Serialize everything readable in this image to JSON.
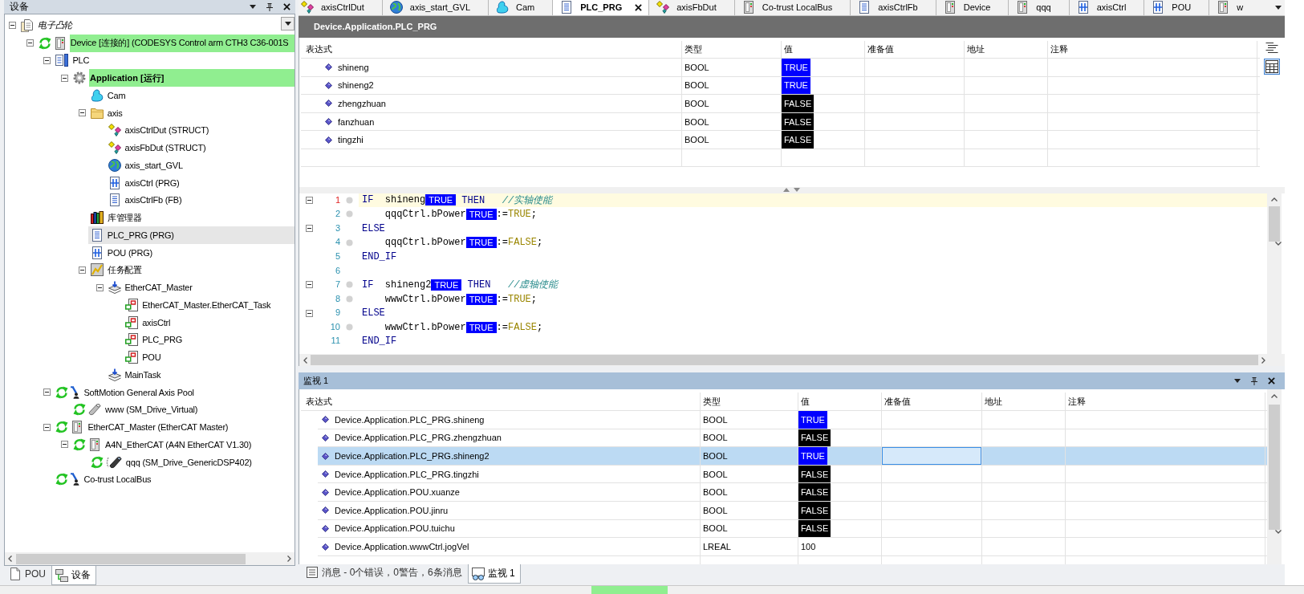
{
  "devices_panel": {
    "title": "设备",
    "tree": [
      {
        "label": "电子凸轮",
        "kind": "project",
        "online": false,
        "highlighted": false,
        "active": false,
        "selected": false,
        "expanded": true,
        "children": [
          {
            "label": "Device [连接的] (CODESYS Control arm CTH3 C36-001S",
            "kind": "device",
            "online": true,
            "highlighted": true,
            "active": false,
            "selected": false,
            "expanded": true,
            "children": [
              {
                "label": "PLC",
                "kind": "plc",
                "online": false,
                "highlighted": false,
                "active": false,
                "selected": false,
                "expanded": true,
                "children": [
                  {
                    "label": "Application [运行]",
                    "kind": "application",
                    "online": false,
                    "highlighted": true,
                    "active": true,
                    "selected": false,
                    "expanded": true,
                    "children": [
                      {
                        "label": "Cam",
                        "kind": "cam",
                        "online": false,
                        "highlighted": false,
                        "active": false,
                        "selected": false,
                        "expanded": false
                      },
                      {
                        "label": "axis",
                        "kind": "folder",
                        "online": false,
                        "highlighted": false,
                        "active": false,
                        "selected": false,
                        "expanded": true,
                        "children": [
                          {
                            "label": "axisCtrlDut (STRUCT)",
                            "kind": "dut",
                            "online": false,
                            "highlighted": false,
                            "active": false,
                            "selected": false,
                            "expanded": false
                          },
                          {
                            "label": "axisFbDut (STRUCT)",
                            "kind": "dut",
                            "online": false,
                            "highlighted": false,
                            "active": false,
                            "selected": false,
                            "expanded": false
                          },
                          {
                            "label": "axis_start_GVL",
                            "kind": "gvl",
                            "online": false,
                            "highlighted": false,
                            "active": false,
                            "selected": false,
                            "expanded": false
                          },
                          {
                            "label": "axisCtrl (PRG)",
                            "kind": "prg",
                            "online": false,
                            "highlighted": false,
                            "active": false,
                            "selected": false,
                            "expanded": false
                          },
                          {
                            "label": "axisCtrlFb (FB)",
                            "kind": "doc",
                            "online": false,
                            "highlighted": false,
                            "active": false,
                            "selected": false,
                            "expanded": false
                          }
                        ]
                      },
                      {
                        "label": "库管理器",
                        "kind": "library",
                        "online": false,
                        "highlighted": false,
                        "active": false,
                        "selected": false,
                        "expanded": false
                      },
                      {
                        "label": "PLC_PRG (PRG)",
                        "kind": "doc",
                        "online": false,
                        "highlighted": false,
                        "active": false,
                        "selected": true,
                        "expanded": false
                      },
                      {
                        "label": "POU (PRG)",
                        "kind": "prg",
                        "online": false,
                        "highlighted": false,
                        "active": false,
                        "selected": false,
                        "expanded": false
                      },
                      {
                        "label": "任务配置",
                        "kind": "taskconfig",
                        "online": false,
                        "highlighted": false,
                        "active": false,
                        "selected": false,
                        "expanded": true,
                        "children": [
                          {
                            "label": "EtherCAT_Master",
                            "kind": "task",
                            "online": false,
                            "highlighted": false,
                            "active": false,
                            "selected": false,
                            "expanded": true,
                            "children": [
                              {
                                "label": "EtherCAT_Master.EtherCAT_Task",
                                "kind": "call",
                                "online": false,
                                "highlighted": false,
                                "active": false,
                                "selected": false,
                                "expanded": false
                              },
                              {
                                "label": "axisCtrl",
                                "kind": "call",
                                "online": false,
                                "highlighted": false,
                                "active": false,
                                "selected": false,
                                "expanded": false
                              },
                              {
                                "label": "PLC_PRG",
                                "kind": "call",
                                "online": false,
                                "highlighted": false,
                                "active": false,
                                "selected": false,
                                "expanded": false
                              },
                              {
                                "label": "POU",
                                "kind": "call",
                                "online": false,
                                "highlighted": false,
                                "active": false,
                                "selected": false,
                                "expanded": false
                              }
                            ]
                          },
                          {
                            "label": "MainTask",
                            "kind": "task",
                            "online": false,
                            "highlighted": false,
                            "active": false,
                            "selected": false,
                            "expanded": false
                          }
                        ]
                      }
                    ]
                  }
                ]
              },
              {
                "label": "SoftMotion General Axis Pool",
                "kind": "pool",
                "online": true,
                "highlighted": false,
                "active": false,
                "selected": false,
                "expanded": true,
                "children": [
                  {
                    "label": "www (SM_Drive_Virtual)",
                    "kind": "drive",
                    "online": true,
                    "highlighted": false,
                    "active": false,
                    "selected": false,
                    "expanded": false
                  }
                ]
              },
              {
                "label": "EtherCAT_Master (EtherCAT Master)",
                "kind": "device",
                "online": true,
                "highlighted": false,
                "active": false,
                "selected": false,
                "expanded": true,
                "children": [
                  {
                    "label": "A4N_EtherCAT (A4N EtherCAT V1.30)",
                    "kind": "device",
                    "online": true,
                    "highlighted": false,
                    "active": false,
                    "selected": false,
                    "expanded": true,
                    "children": [
                      {
                        "label": "qqq (SM_Drive_GenericDSP402)",
                        "kind": "drive_linked",
                        "online": true,
                        "highlighted": false,
                        "active": false,
                        "selected": false,
                        "expanded": false
                      }
                    ]
                  }
                ]
              },
              {
                "label": "Co-trust LocalBus",
                "kind": "pool",
                "online": true,
                "highlighted": false,
                "active": false,
                "selected": false,
                "expanded": false
              }
            ]
          }
        ]
      }
    ],
    "tabs": [
      {
        "label": "POU",
        "kind": "pou",
        "selected": false
      },
      {
        "label": "设备",
        "kind": "devices",
        "selected": true
      }
    ]
  },
  "editor": {
    "tabs": [
      {
        "label": "axisCtrlDut",
        "kind": "dut",
        "selected": false
      },
      {
        "label": "axis_start_GVL",
        "kind": "gvl",
        "selected": false
      },
      {
        "label": "Cam",
        "kind": "cam",
        "selected": false
      },
      {
        "label": "PLC_PRG",
        "kind": "doc",
        "selected": true
      },
      {
        "label": "axisFbDut",
        "kind": "dut",
        "selected": false
      },
      {
        "label": "Co-trust LocalBus",
        "kind": "device",
        "selected": false
      },
      {
        "label": "axisCtrlFb",
        "kind": "doc",
        "selected": false
      },
      {
        "label": "Device",
        "kind": "device",
        "selected": false
      },
      {
        "label": "qqq",
        "kind": "device",
        "selected": false
      },
      {
        "label": "axisCtrl",
        "kind": "prg",
        "selected": false
      },
      {
        "label": "POU",
        "kind": "prg",
        "selected": false
      },
      {
        "label": "w",
        "kind": "device",
        "selected": false
      }
    ],
    "title": "Device.Application.PLC_PRG",
    "variables": {
      "columns": [
        "表达式",
        "类型",
        "值",
        "准备值",
        "地址",
        "注释"
      ],
      "rows": [
        {
          "expression": "shineng",
          "type": "BOOL",
          "value": "TRUE",
          "color": "#0000ff"
        },
        {
          "expression": "shineng2",
          "type": "BOOL",
          "value": "TRUE",
          "color": "#0000ff"
        },
        {
          "expression": "zhengzhuan",
          "type": "BOOL",
          "value": "FALSE",
          "color": "#000000"
        },
        {
          "expression": "fanzhuan",
          "type": "BOOL",
          "value": "FALSE",
          "color": "#000000"
        },
        {
          "expression": "tingzhi",
          "type": "BOOL",
          "value": "FALSE",
          "color": "#000000"
        }
      ]
    },
    "view_buttons": [
      {
        "kind": "lines",
        "selected": false
      },
      {
        "kind": "table",
        "selected": true
      }
    ],
    "code": [
      {
        "number": "1",
        "fold": true,
        "breakpoint_slot": true,
        "selected": true,
        "tokens": [
          {
            "kind": "keyword",
            "text": "IF"
          },
          {
            "kind": "plain",
            "text": "  shineng"
          },
          {
            "kind": "monitor",
            "text": "TRUE",
            "color": "#0000ff"
          },
          {
            "kind": "keyword",
            "text": " THEN"
          },
          {
            "kind": "comment",
            "text": "   //实轴使能"
          }
        ]
      },
      {
        "number": "2",
        "fold": false,
        "breakpoint_slot": true,
        "selected": false,
        "tokens": [
          {
            "kind": "plain",
            "text": "    qqqCtrl.bPower"
          },
          {
            "kind": "monitor",
            "text": "TRUE",
            "color": "#0000ff"
          },
          {
            "kind": "plain",
            "text": ":="
          },
          {
            "kind": "literal",
            "text": "TRUE"
          },
          {
            "kind": "plain",
            "text": ";"
          }
        ]
      },
      {
        "number": "3",
        "fold": true,
        "breakpoint_slot": false,
        "selected": false,
        "tokens": [
          {
            "kind": "keyword",
            "text": "ELSE"
          }
        ]
      },
      {
        "number": "4",
        "fold": false,
        "breakpoint_slot": true,
        "selected": false,
        "tokens": [
          {
            "kind": "plain",
            "text": "    qqqCtrl.bPower"
          },
          {
            "kind": "monitor",
            "text": "TRUE",
            "color": "#0000ff"
          },
          {
            "kind": "plain",
            "text": ":="
          },
          {
            "kind": "literal",
            "text": "FALSE"
          },
          {
            "kind": "plain",
            "text": ";"
          }
        ]
      },
      {
        "number": "5",
        "fold": false,
        "breakpoint_slot": false,
        "selected": false,
        "tokens": [
          {
            "kind": "keyword",
            "text": "END_IF"
          }
        ]
      },
      {
        "number": "6",
        "fold": false,
        "breakpoint_slot": false,
        "selected": false
      },
      {
        "number": "7",
        "fold": true,
        "breakpoint_slot": true,
        "selected": false,
        "tokens": [
          {
            "kind": "keyword",
            "text": "IF"
          },
          {
            "kind": "plain",
            "text": "  shineng2"
          },
          {
            "kind": "monitor",
            "text": "TRUE",
            "color": "#0000ff"
          },
          {
            "kind": "keyword",
            "text": " THEN"
          },
          {
            "kind": "comment",
            "text": "   //虚轴使能"
          }
        ]
      },
      {
        "number": "8",
        "fold": false,
        "breakpoint_slot": true,
        "selected": false,
        "tokens": [
          {
            "kind": "plain",
            "text": "    wwwCtrl.bPower"
          },
          {
            "kind": "monitor",
            "text": "TRUE",
            "color": "#0000ff"
          },
          {
            "kind": "plain",
            "text": ":="
          },
          {
            "kind": "literal",
            "text": "TRUE"
          },
          {
            "kind": "plain",
            "text": ";"
          }
        ]
      },
      {
        "number": "9",
        "fold": true,
        "breakpoint_slot": false,
        "selected": false,
        "tokens": [
          {
            "kind": "keyword",
            "text": "ELSE"
          }
        ]
      },
      {
        "number": "10",
        "fold": false,
        "breakpoint_slot": true,
        "selected": false,
        "tokens": [
          {
            "kind": "plain",
            "text": "    wwwCtrl.bPower"
          },
          {
            "kind": "monitor",
            "text": "TRUE",
            "color": "#0000ff"
          },
          {
            "kind": "plain",
            "text": ":="
          },
          {
            "kind": "literal",
            "text": "FALSE"
          },
          {
            "kind": "plain",
            "text": ";"
          }
        ]
      },
      {
        "number": "11",
        "fold": false,
        "breakpoint_slot": false,
        "selected": false,
        "tokens": [
          {
            "kind": "keyword",
            "text": "END_IF"
          }
        ]
      }
    ]
  },
  "watch": {
    "title": "监视 1",
    "columns": [
      "表达式",
      "类型",
      "值",
      "准备值",
      "地址",
      "注释"
    ],
    "rows": [
      {
        "expression": "Device.Application.PLC_PRG.shineng",
        "type": "BOOL",
        "value": "TRUE",
        "color": "#0000ff",
        "selected": false
      },
      {
        "expression": "Device.Application.PLC_PRG.zhengzhuan",
        "type": "BOOL",
        "value": "FALSE",
        "color": "#000000",
        "selected": false
      },
      {
        "expression": "Device.Application.PLC_PRG.shineng2",
        "type": "BOOL",
        "value": "TRUE",
        "color": "#0000ff",
        "selected": true
      },
      {
        "expression": "Device.Application.PLC_PRG.tingzhi",
        "type": "BOOL",
        "value": "FALSE",
        "color": "#000000",
        "selected": false
      },
      {
        "expression": "Device.Application.POU.xuanze",
        "type": "BOOL",
        "value": "FALSE",
        "color": "#000000",
        "selected": false
      },
      {
        "expression": "Device.Application.POU.jinru",
        "type": "BOOL",
        "value": "FALSE",
        "color": "#000000",
        "selected": false
      },
      {
        "expression": "Device.Application.POU.tuichu",
        "type": "BOOL",
        "value": "FALSE",
        "color": "#000000",
        "selected": false
      },
      {
        "expression": "Device.Application.wwwCtrl.jogVel",
        "type": "LREAL",
        "value": "100",
        "selected": false
      }
    ]
  },
  "bottom_tabs": [
    {
      "label": "消息 - 0个错误，0警告，6条消息",
      "kind": "messages",
      "selected": false
    },
    {
      "label": "监视 1",
      "kind": "watch",
      "selected": true
    }
  ]
}
